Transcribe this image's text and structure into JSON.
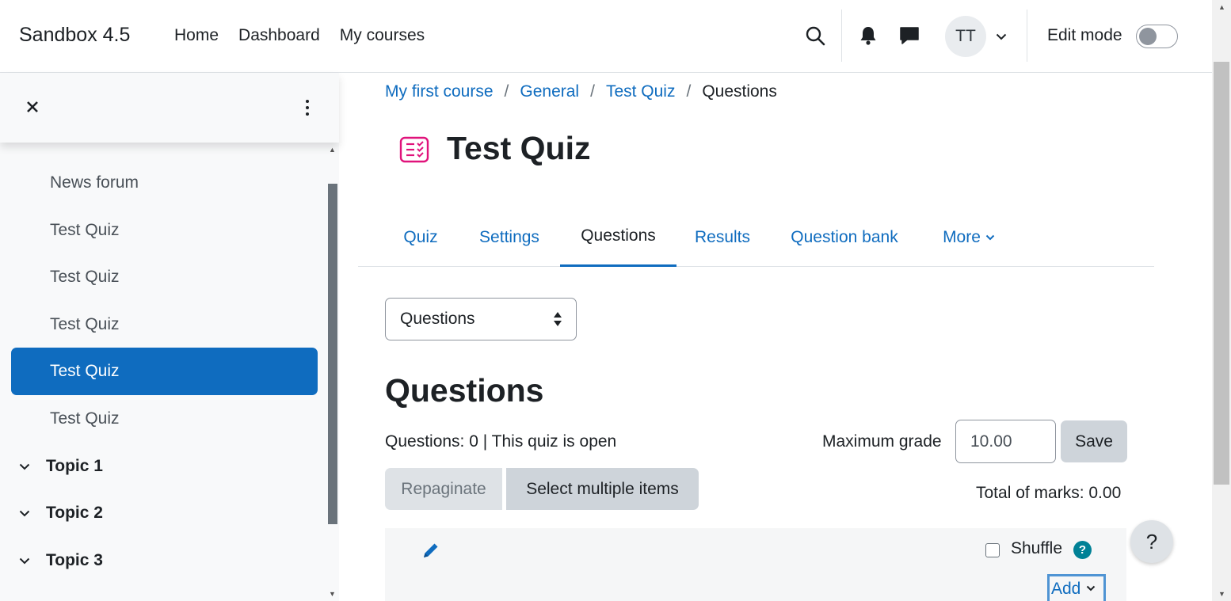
{
  "navbar": {
    "brand": "Sandbox 4.5",
    "links": [
      "Home",
      "Dashboard",
      "My courses"
    ],
    "avatar_initials": "TT",
    "edit_mode_label": "Edit mode"
  },
  "drawer": {
    "items": [
      {
        "label": "News forum",
        "active": false
      },
      {
        "label": "Test Quiz",
        "active": false
      },
      {
        "label": "Test Quiz",
        "active": false
      },
      {
        "label": "Test Quiz",
        "active": false
      },
      {
        "label": "Test Quiz",
        "active": true
      },
      {
        "label": "Test Quiz",
        "active": false
      }
    ],
    "topics": [
      "Topic 1",
      "Topic 2",
      "Topic 3"
    ]
  },
  "breadcrumb": {
    "items": [
      "My first course",
      "General",
      "Test Quiz"
    ],
    "current": "Questions"
  },
  "page_title": "Test Quiz",
  "tabs": [
    "Quiz",
    "Settings",
    "Questions",
    "Results",
    "Question bank",
    "More"
  ],
  "active_tab": "Questions",
  "select_value": "Questions",
  "section_heading": "Questions",
  "status_text": "Questions: 0 | This quiz is open",
  "max_grade": {
    "label": "Maximum grade",
    "value": "10.00",
    "save_label": "Save"
  },
  "buttons": {
    "repaginate": "Repaginate",
    "select_multiple": "Select multiple items"
  },
  "total_marks": "Total of marks: 0.00",
  "section": {
    "shuffle_label": "Shuffle",
    "add_label": "Add"
  },
  "float_help": "?",
  "colors": {
    "primary": "#0f6cbf",
    "info": "#008196",
    "quiz_icon": "#e0137b"
  }
}
